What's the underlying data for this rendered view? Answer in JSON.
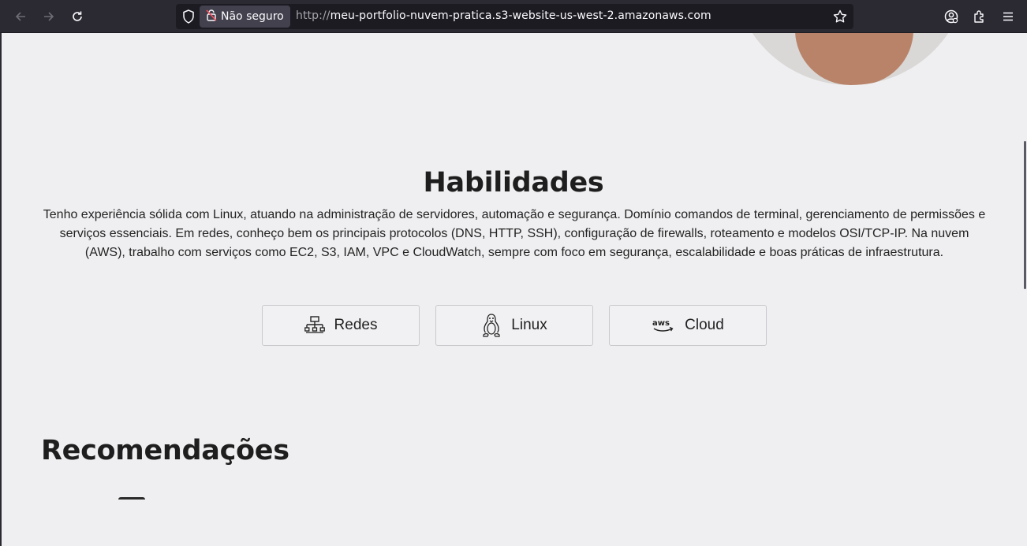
{
  "browser": {
    "insecure_label": "Não seguro",
    "url_protocol": "http://",
    "url_host": "meu-portfolio-nuvem-pratica.s3-website-us-west-2.amazonaws.com",
    "icons": [
      "back-icon",
      "forward-icon",
      "reload-icon",
      "shield-icon",
      "insecure-lock-icon",
      "bookmark-star-icon",
      "account-icon",
      "extensions-icon",
      "menu-icon"
    ]
  },
  "skills": {
    "title": "Habilidades",
    "description": "Tenho experiência sólida com Linux, atuando na administração de servidores, automação e segurança. Domínio comandos de terminal, gerenciamento de permissões e serviços essenciais. Em redes, conheço bem os principais protocolos (DNS, HTTP, SSH), configuração de firewalls, roteamento e modelos OSI/TCP-IP. Na nuvem (AWS), trabalho com serviços como EC2, S3, IAM, VPC e CloudWatch, sempre com foco em segurança, escalabilidade e boas práticas de infraestrutura.",
    "buttons": [
      {
        "label": "Redes",
        "icon": "network-icon"
      },
      {
        "label": "Linux",
        "icon": "tux-icon"
      },
      {
        "label": "Cloud",
        "icon": "aws-icon"
      }
    ]
  },
  "recommendations": {
    "title": "Recomendações"
  }
}
